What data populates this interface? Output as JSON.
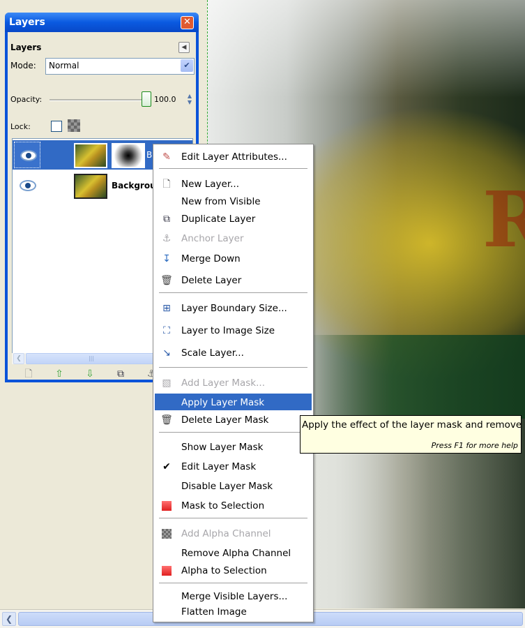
{
  "canvas": {
    "text_visible": "RI"
  },
  "layers_panel": {
    "window_title": "Layers",
    "header": "Layers",
    "mode_label": "Mode:",
    "mode_value": "Normal",
    "opacity_label": "Opacity:",
    "opacity_value": "100.0",
    "lock_label": "Lock:",
    "layers": [
      {
        "name": "Blur",
        "selected": true,
        "has_mask": true
      },
      {
        "name": "Backgrou",
        "selected": false,
        "has_mask": false
      }
    ],
    "scrollbar_grip": "|||"
  },
  "context_menu": {
    "items": [
      {
        "label": "Edit Layer Attributes...",
        "icon": "edit-icon",
        "enabled": true
      },
      {
        "label": "New Layer...",
        "icon": "new-layer-icon",
        "enabled": true
      },
      {
        "label": "New from Visible",
        "icon": "",
        "enabled": true
      },
      {
        "label": "Duplicate Layer",
        "icon": "duplicate-icon",
        "enabled": true
      },
      {
        "label": "Anchor Layer",
        "icon": "anchor-icon",
        "enabled": false
      },
      {
        "label": "Merge Down",
        "icon": "merge-down-icon",
        "enabled": true
      },
      {
        "label": "Delete Layer",
        "icon": "trash-icon",
        "enabled": true
      },
      {
        "label": "Layer Boundary Size...",
        "icon": "boundary-icon",
        "enabled": true
      },
      {
        "label": "Layer to Image Size",
        "icon": "layer-to-image-icon",
        "enabled": true
      },
      {
        "label": "Scale Layer...",
        "icon": "scale-icon",
        "enabled": true
      },
      {
        "label": "Add Layer Mask...",
        "icon": "add-mask-icon",
        "enabled": false
      },
      {
        "label": "Apply Layer Mask",
        "icon": "",
        "enabled": true,
        "highlighted": true
      },
      {
        "label": "Delete Layer Mask",
        "icon": "trash-icon",
        "enabled": true
      },
      {
        "label": "Show Layer Mask",
        "icon": "",
        "enabled": true
      },
      {
        "label": "Edit Layer Mask",
        "icon": "checkmark-icon",
        "enabled": true,
        "checked": true
      },
      {
        "label": "Disable Layer Mask",
        "icon": "",
        "enabled": true
      },
      {
        "label": "Mask to Selection",
        "icon": "selection-icon",
        "enabled": true
      },
      {
        "label": "Add Alpha Channel",
        "icon": "alpha-icon",
        "enabled": false
      },
      {
        "label": "Remove Alpha Channel",
        "icon": "",
        "enabled": true
      },
      {
        "label": "Alpha to Selection",
        "icon": "selection-icon",
        "enabled": true
      },
      {
        "label": "Merge Visible Layers...",
        "icon": "",
        "enabled": true
      },
      {
        "label": "Flatten Image",
        "icon": "",
        "enabled": true
      }
    ]
  },
  "tooltip": {
    "text": "Apply the effect of the layer mask and remove it",
    "help": "Press F1 for more help"
  },
  "colors": {
    "selection": "#316ac5",
    "titlebar": "#0a53d9",
    "tooltip_bg": "#ffffe1"
  }
}
